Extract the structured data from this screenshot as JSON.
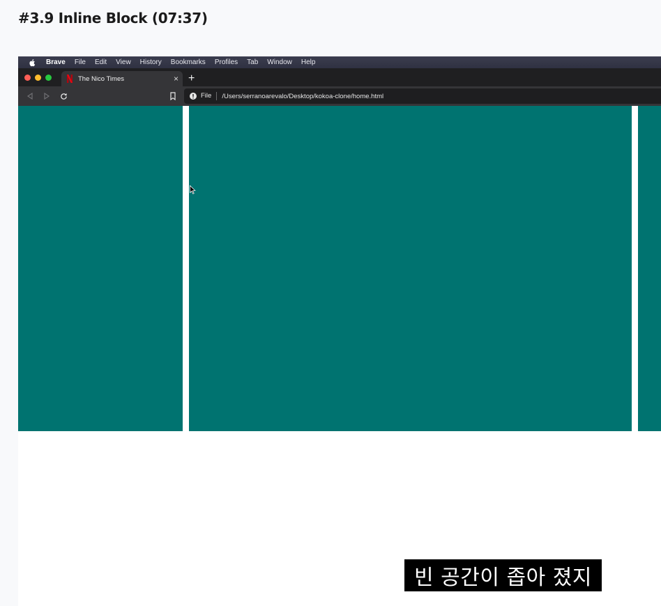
{
  "lesson": {
    "title": "#3.9 Inline Block (07:37)"
  },
  "menubar": {
    "apple_icon": "apple-icon",
    "items": [
      "Brave",
      "File",
      "Edit",
      "View",
      "History",
      "Bookmarks",
      "Profiles",
      "Tab",
      "Window",
      "Help"
    ]
  },
  "tab": {
    "title": "The Nico Times",
    "close_label": "×",
    "new_tab_label": "+"
  },
  "toolbar": {
    "scheme": "File",
    "url": "/Users/serranoarevalo/Desktop/kokoa-clone/home.html"
  },
  "page": {
    "block_color": "#007370",
    "background": "#ffffff"
  },
  "subtitle": {
    "text": "빈 공간이 좁아 졌지"
  }
}
